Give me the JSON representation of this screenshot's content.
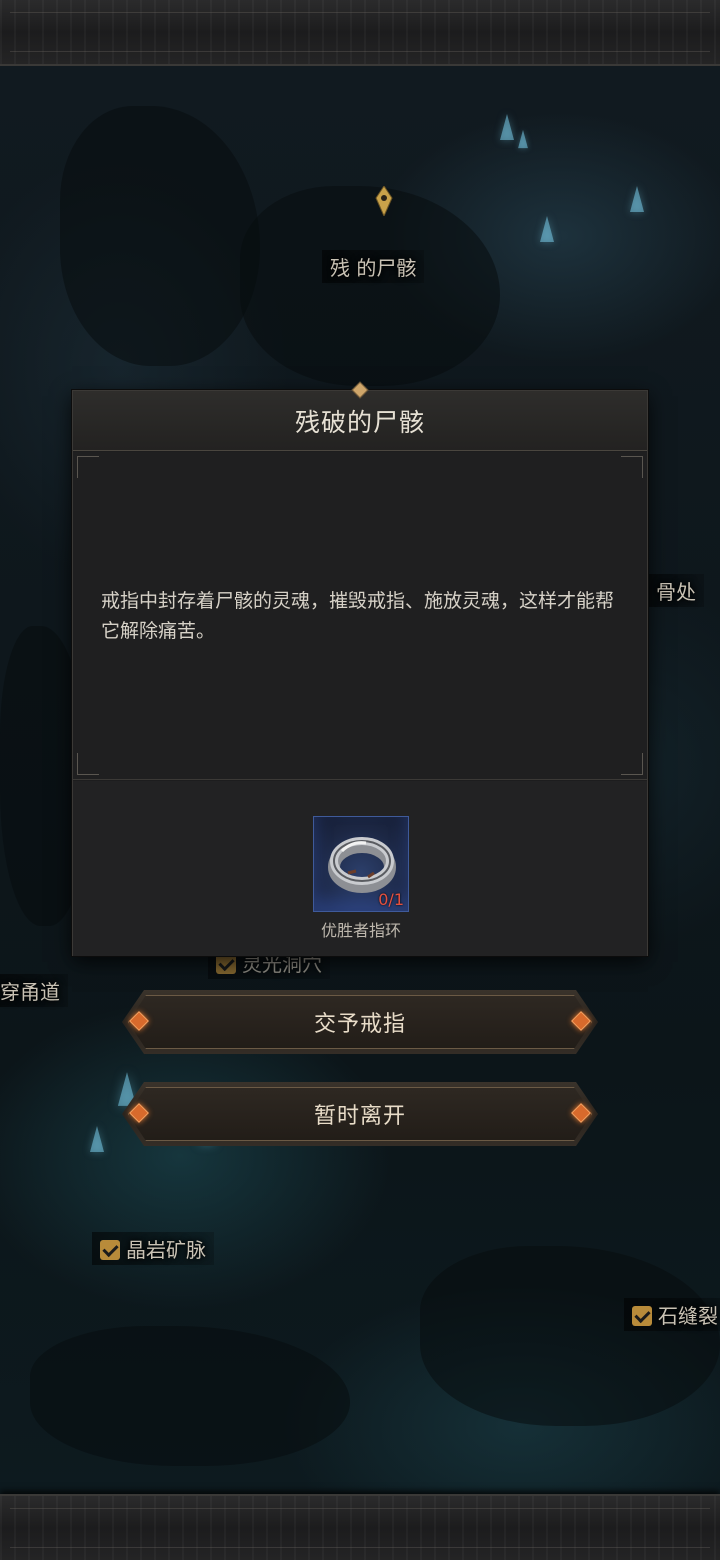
{
  "map": {
    "labels": {
      "top_location": "残 的尸骸",
      "right_partial": "骨处",
      "left_passage": "穿甬道",
      "hidden_under": "灵光洞穴",
      "crystal_vein": "晶岩矿脉",
      "stone_crack": "石缝裂"
    }
  },
  "dialog": {
    "title": "残破的尸骸",
    "description": "戒指中封存着尸骸的灵魂，摧毁戒指、施放灵魂，这样才能帮它解除痛苦。",
    "required_item": {
      "name": "优胜者指环",
      "count": "0/1",
      "icon": "ring-icon"
    }
  },
  "actions": {
    "give_ring": "交予戒指",
    "leave": "暂时离开"
  },
  "colors": {
    "accent_orange": "#d86a2c",
    "count_red": "#e4503e",
    "check_gold": "#b88b3a"
  }
}
